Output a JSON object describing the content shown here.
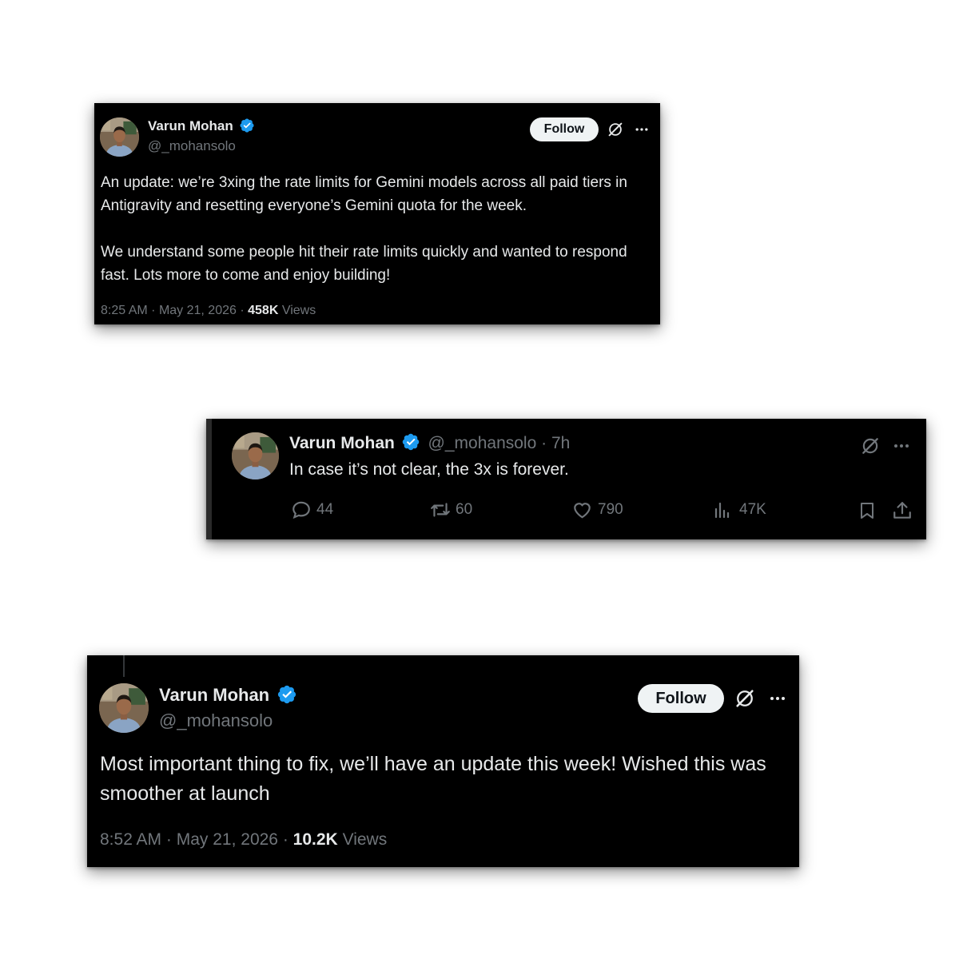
{
  "tweet1": {
    "name": "Varun Mohan",
    "handle": "@_mohansolo",
    "follow_label": "Follow",
    "paragraph1": "An update: we’re 3xing the rate limits for Gemini models across all paid tiers in Antigravity and resetting everyone’s Gemini quota for the week.",
    "paragraph2": "We understand some people hit their rate limits quickly and wanted to respond fast. Lots more to come and enjoy building!",
    "time": "8:25 AM",
    "date": "May 21, 2026",
    "views_count": "458K",
    "views_label": "Views"
  },
  "tweet2": {
    "name": "Varun Mohan",
    "handle": "@_mohansolo",
    "age": "7h",
    "text": "In case it’s not clear, the 3x is forever.",
    "replies": "44",
    "reposts": "60",
    "likes": "790",
    "views": "47K"
  },
  "tweet3": {
    "name": "Varun Mohan",
    "handle": "@_mohansolo",
    "follow_label": "Follow",
    "text": "Most important thing to fix, we’ll have an update this week! Wished this was smoother at launch",
    "time": "8:52 AM",
    "date": "May 21, 2026",
    "views_count": "10.2K",
    "views_label": "Views"
  },
  "colors": {
    "verified": "#1d9bf0",
    "card_bg": "#000000",
    "text": "#e7e9ea",
    "muted": "#71767b"
  },
  "icons": [
    "verified-badge-icon",
    "grok-icon",
    "more-icon",
    "reply-icon",
    "repost-icon",
    "like-icon",
    "views-icon",
    "bookmark-icon",
    "share-icon"
  ]
}
